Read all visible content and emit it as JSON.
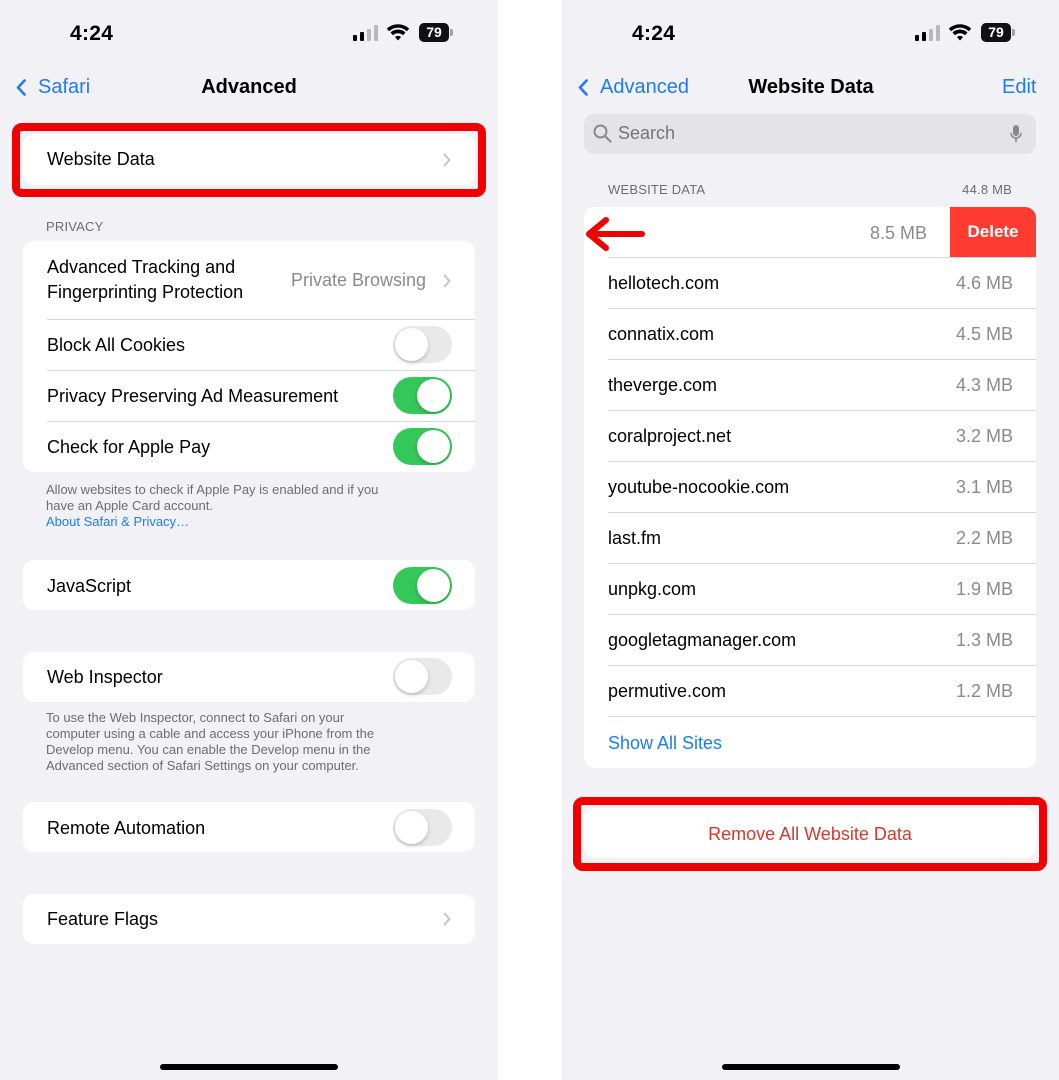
{
  "status_bar": {
    "time": "4:24",
    "battery": "79"
  },
  "left": {
    "back_label": "Safari",
    "title": "Advanced",
    "website_data_label": "Website Data",
    "privacy_header": "PRIVACY",
    "tracking_label_line1": "Advanced Tracking and",
    "tracking_label_line2": "Fingerprinting Protection",
    "tracking_value": "Private Browsing",
    "block_cookies_label": "Block All Cookies",
    "block_cookies_on": false,
    "ad_measurement_label": "Privacy Preserving Ad Measurement",
    "ad_measurement_on": true,
    "apple_pay_label": "Check for Apple Pay",
    "apple_pay_on": true,
    "apple_pay_footer_line1": "Allow websites to check if Apple Pay is enabled and if you",
    "apple_pay_footer_line2": "have an Apple Card account.",
    "about_link": "About Safari & Privacy…",
    "javascript_label": "JavaScript",
    "javascript_on": true,
    "web_inspector_label": "Web Inspector",
    "web_inspector_on": false,
    "web_inspector_footer_line1": "To use the Web Inspector, connect to Safari on your",
    "web_inspector_footer_line2": "computer using a cable and access your iPhone from the",
    "web_inspector_footer_line3": "Develop menu. You can enable the Develop menu in the",
    "web_inspector_footer_line4": "Advanced section of Safari Settings on your computer.",
    "remote_automation_label": "Remote Automation",
    "remote_automation_on": false,
    "feature_flags_label": "Feature Flags"
  },
  "right": {
    "back_label": "Advanced",
    "title": "Website Data",
    "edit_label": "Edit",
    "search_placeholder": "Search",
    "section_header": "WEBSITE DATA",
    "total_size": "44.8 MB",
    "swiped_size": "8.5 MB",
    "delete_label": "Delete",
    "sites": [
      {
        "name": "hellotech.com",
        "size": "4.6 MB"
      },
      {
        "name": "connatix.com",
        "size": "4.5 MB"
      },
      {
        "name": "theverge.com",
        "size": "4.3 MB"
      },
      {
        "name": "coralproject.net",
        "size": "3.2 MB"
      },
      {
        "name": "youtube-nocookie.com",
        "size": "3.1 MB"
      },
      {
        "name": "last.fm",
        "size": "2.2 MB"
      },
      {
        "name": "unpkg.com",
        "size": "1.9 MB"
      },
      {
        "name": "googletagmanager.com",
        "size": "1.3 MB"
      },
      {
        "name": "permutive.com",
        "size": "1.2 MB"
      }
    ],
    "show_all_label": "Show All Sites",
    "remove_all_label": "Remove All Website Data"
  },
  "colors": {
    "accent": "#1e7cf2",
    "toggle_on": "#34c759",
    "delete_red": "#fe3b30",
    "annotation_red": "#f00000",
    "remove_text": "#d5382e"
  },
  "icons": [
    "cellular-signal-icon",
    "wifi-icon",
    "battery-icon",
    "chevron-left-icon",
    "chevron-right-icon",
    "search-icon",
    "microphone-icon",
    "red-arrow-left-icon"
  ]
}
